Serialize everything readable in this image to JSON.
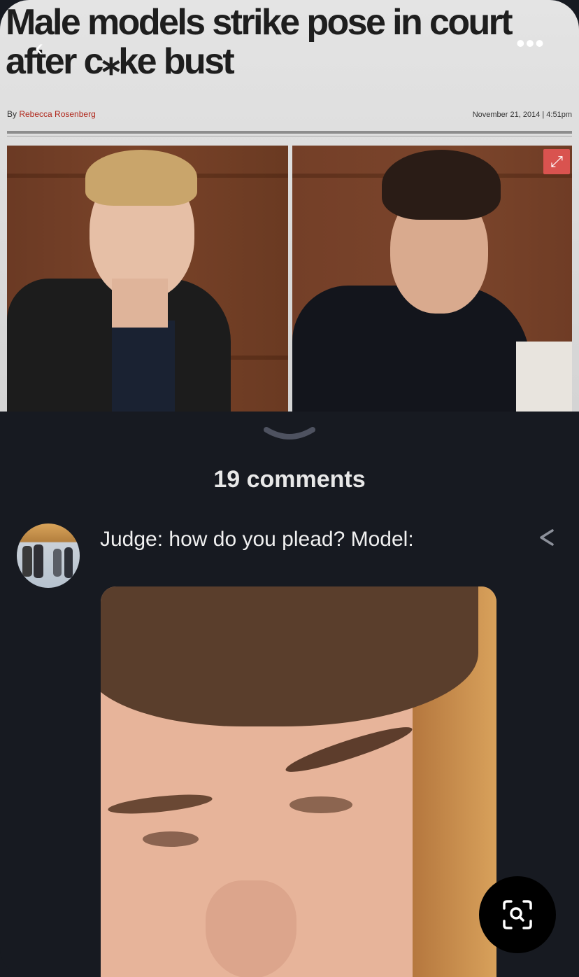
{
  "article": {
    "headline_line1": "Male models strike pose in court",
    "headline_line2": "after c⁎ke bust",
    "byline_prefix": "By ",
    "byline_author": "Rebecca Rosenberg",
    "dateline": "November 21, 2014 | 4:51pm"
  },
  "nav": {
    "back_glyph": "‹",
    "more_glyph": "•••"
  },
  "thread": {
    "comment_count": "19 comments",
    "caption": "Judge: how do you plead? Model:"
  },
  "icons": {
    "back": "chevron-left-icon",
    "more": "more-horizontal-icon",
    "expand": "expand-icon",
    "collapse": "chevron-down-icon",
    "share": "share-icon",
    "visual_search": "lens-search-icon"
  },
  "colors": {
    "background": "#171a21",
    "text": "#f0f0f0",
    "accent_red": "#d9534f"
  }
}
